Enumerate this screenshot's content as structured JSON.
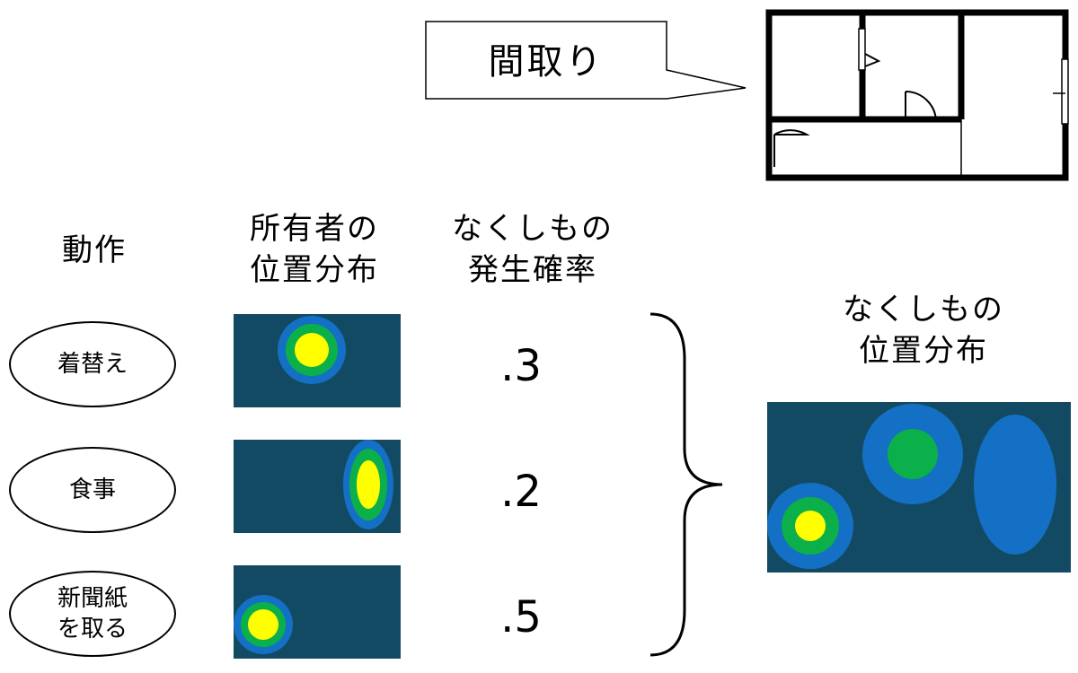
{
  "callout": {
    "label": "間取り"
  },
  "headers": {
    "action": "動作",
    "owner_dist_line1": "所有者の",
    "owner_dist_line2": "位置分布",
    "prob_line1": "なくしもの",
    "prob_line2": "発生確率",
    "result_line1": "なくしもの",
    "result_line2": "位置分布"
  },
  "rows": [
    {
      "action_line1": "着替え",
      "action_line2": "",
      "probability": ".3"
    },
    {
      "action_line1": "食事",
      "action_line2": "",
      "probability": ".2"
    },
    {
      "action_line1": "新聞紙",
      "action_line2": "を取る",
      "probability": ".5"
    }
  ],
  "colors": {
    "heatmap_bg": "#134a63",
    "outer": "#1470c4",
    "middle": "#0bb04a",
    "inner": "#ffff00"
  }
}
